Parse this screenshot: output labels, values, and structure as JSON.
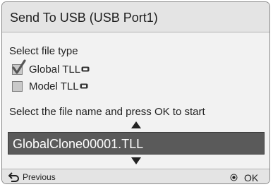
{
  "dialog": {
    "title": "Send To USB (USB Port1)",
    "file_type_label": "Select file type",
    "options": [
      {
        "label": "Global TLL",
        "checked": true,
        "icon": "usb-icon"
      },
      {
        "label": "Model TLL",
        "checked": false,
        "icon": "usb-icon"
      }
    ],
    "instruction": "Select the file name and press OK to start",
    "filename": "GlobalClone00001.TLL"
  },
  "footer": {
    "previous_label": "Previous",
    "previous_icon": "return-arrow-icon",
    "ok_label": "OK",
    "ok_icon": "ok-dot-icon"
  },
  "colors": {
    "dialog_background": "#f2f2f2",
    "title_background": "#e4e4e4",
    "selected_field": "#5a5a5a",
    "selected_text": "#ffffff",
    "text": "#222222"
  }
}
